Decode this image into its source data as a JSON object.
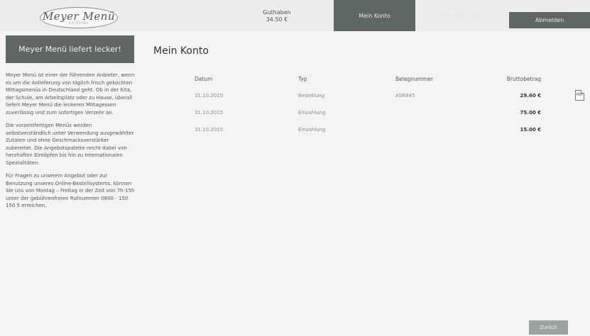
{
  "header": {
    "logo_text": "Meyer Menü",
    "logo_sub": "CATERING",
    "guthaben_label": "Guthaben",
    "guthaben_amount": "34.50 €",
    "nav_konto": "Mein Konto",
    "nav_history": "Mein Wochen",
    "logout_label": "Abmelden"
  },
  "sidebar": {
    "title": "Meyer Menü liefert lecker!",
    "paragraphs": [
      "Meyer Menü ist einer der führenden Anbieter, wenn es um die Anlieferung von täglich frisch gekochten Mittagsmenüs in Deutschland geht. Ob in der Kita, der Schule, am Arbeitsplatz oder zu Hause, überall liefert Meyer Menü die leckeren Mittagessen zuverlässig und zum sofortigen Verzehr an.",
      "Die vorzentfertigen Menüs werden selbstverständlich unter Verwendung ausgewählter Zutaten und ohne Geschmacksverstärker zubereitet. Die Angebotspalette reicht dabei von herzhaften Eintöpfen bis hin zu Internationalen Spezialitäten.",
      "Für Fragen zu unserem Angebot oder zur Benutzung unseres Online-Bestellsystems, können Sie uns von Montag – Freitag in der Zeit von 7h-15h unter der gebührenfreien Rufnummer 0800 - 150 150 5 erreichen."
    ]
  },
  "main": {
    "title": "Mein Konto",
    "columns": [
      "Datum",
      "Typ",
      "Belegnummer",
      "Bruttobetrag"
    ],
    "rows": [
      {
        "date": "31.10.2015",
        "type": "Bestellung",
        "number": "ASR845",
        "amount": "29.60 €"
      },
      {
        "date": "31.10.2015",
        "type": "Einzahlung",
        "number": "",
        "amount": "75.00 €"
      },
      {
        "date": "31.10.2015",
        "type": "Einzahlung",
        "number": "",
        "amount": "15.00 €"
      }
    ],
    "pdf_icon_label": "PDF",
    "back_label": "Zurück"
  }
}
